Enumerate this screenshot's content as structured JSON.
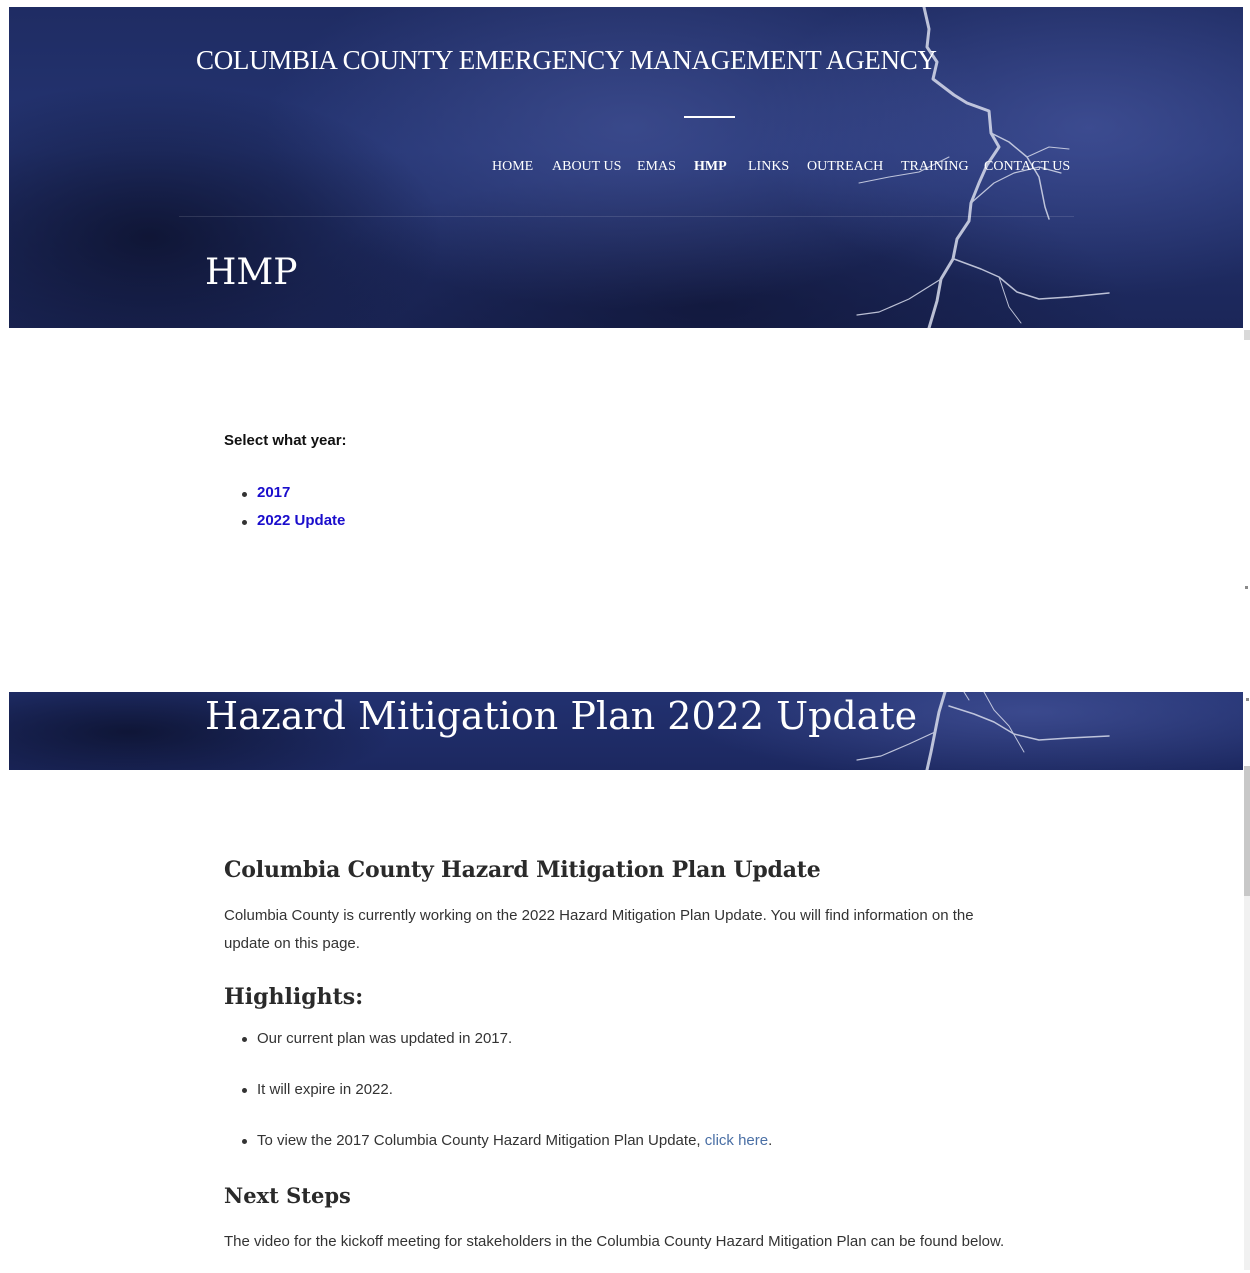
{
  "header": {
    "site_title": "COLUMBIA COUNTY EMERGENCY MANAGEMENT AGENCY",
    "nav": [
      {
        "label": "HOME",
        "active": false
      },
      {
        "label": "ABOUT US",
        "active": false
      },
      {
        "label": "EMAS",
        "active": false
      },
      {
        "label": "HMP",
        "active": true
      },
      {
        "label": "LINKS",
        "active": false
      },
      {
        "label": "OUTREACH",
        "active": false
      },
      {
        "label": "TRAINING",
        "active": false
      },
      {
        "label": "CONTACT US",
        "active": false
      }
    ],
    "page_heading": "HMP"
  },
  "year_select": {
    "label": "Select what year:",
    "options": [
      "2017",
      "2022 Update"
    ]
  },
  "update_page": {
    "banner_heading": "Hazard Mitigation Plan 2022 Update",
    "section_title": "Columbia County Hazard Mitigation Plan Update",
    "intro": "Columbia County is currently working on the 2022 Hazard Mitigation Plan Update. You will find information on the update on this page.",
    "highlights_title": "Highlights:",
    "highlights": [
      "Our current plan was updated in 2017.",
      "It will expire in 2022."
    ],
    "highlight_link": {
      "prefix": "To view the 2017 Columbia County Hazard Mitigation Plan Update,",
      "link_text": "click here",
      "suffix": "."
    },
    "next_steps_title": "Next Steps",
    "next_steps_text": "The video for the kickoff meeting for stakeholders in the Columbia County Hazard Mitigation Plan can be found below."
  },
  "colors": {
    "hero_blue": "#223170",
    "nav_text": "#ffffff",
    "year_link": "#1a0dcc",
    "inline_link": "#4a6fa5"
  }
}
